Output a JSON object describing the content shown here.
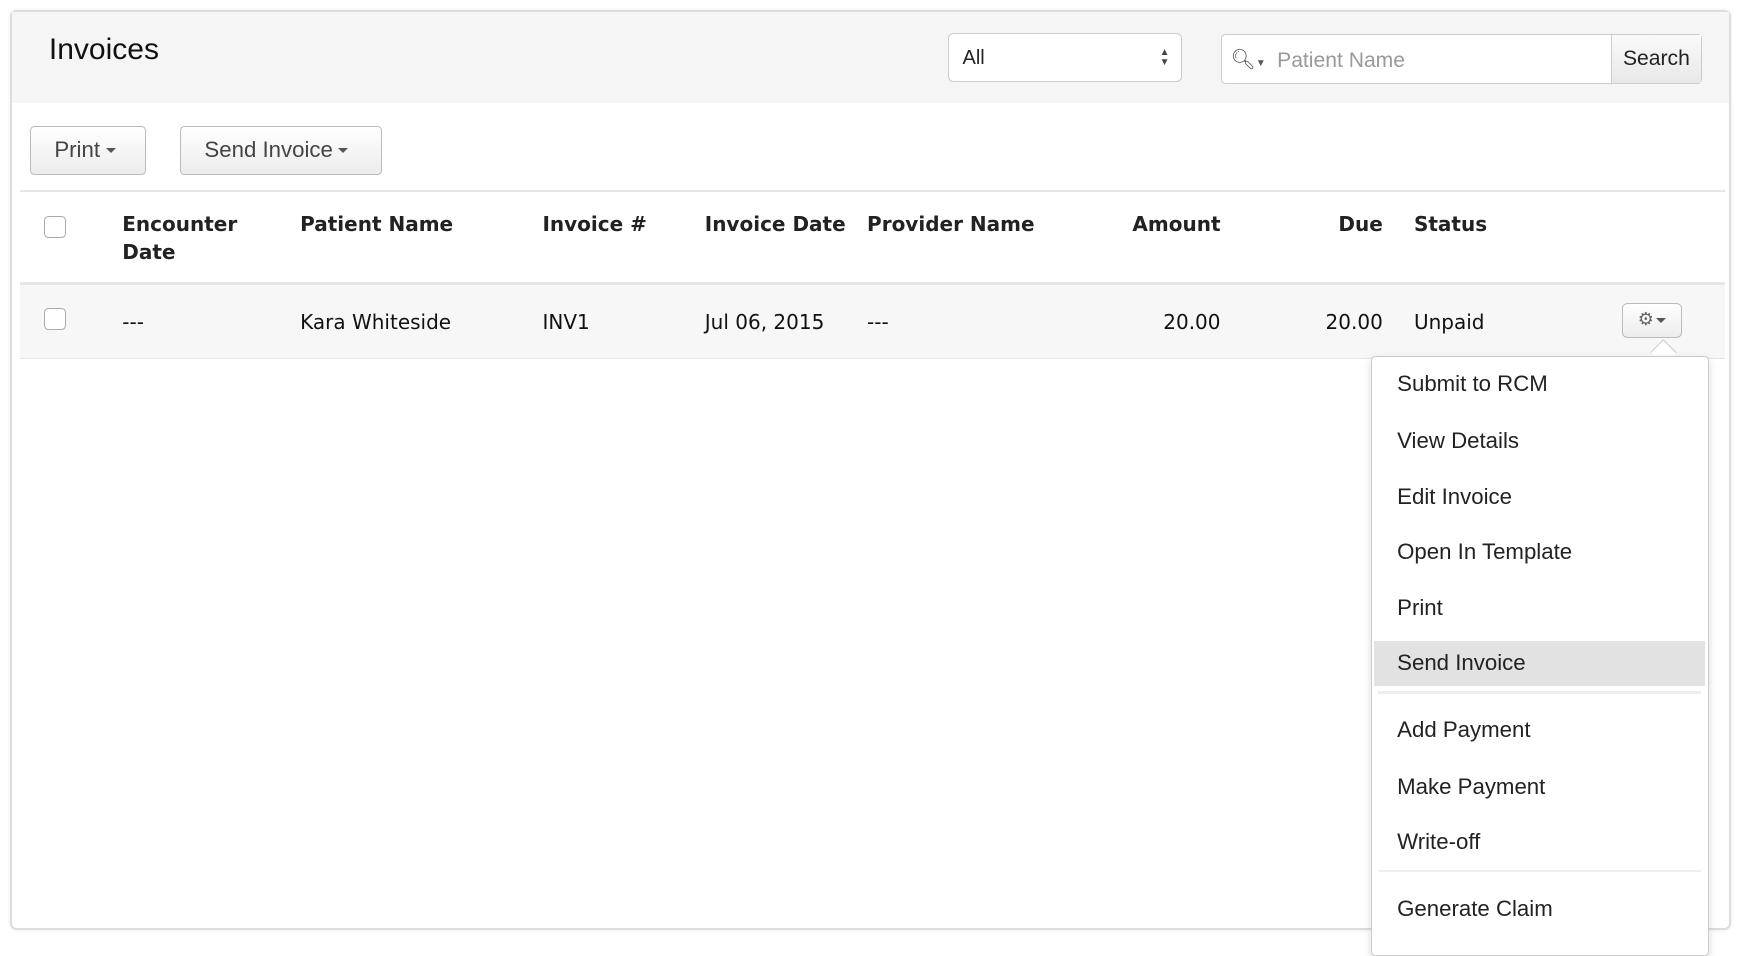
{
  "header": {
    "title": "Invoices",
    "filter_value": "All",
    "search_placeholder": "Patient Name",
    "search_button": "Search"
  },
  "toolbar": {
    "print_label": "Print",
    "send_invoice_label": "Send Invoice"
  },
  "table": {
    "columns": [
      "Encounter Date",
      "Patient Name",
      "Invoice #",
      "Invoice Date",
      "Provider Name",
      "Amount",
      "Due",
      "Status"
    ],
    "column_encounter_line1": "Encounter",
    "column_encounter_line2": "Date",
    "rows": [
      {
        "encounter_date": "---",
        "patient_name": "Kara Whiteside",
        "invoice_no": "INV1",
        "invoice_date": "Jul 06, 2015",
        "provider_name": "---",
        "amount": "20.00",
        "due": "20.00",
        "status": "Unpaid"
      }
    ]
  },
  "menu": {
    "items": [
      "Submit to RCM",
      "View Details",
      "Edit Invoice",
      "Open In Template",
      "Print",
      "Send Invoice",
      "Add Payment",
      "Make Payment",
      "Write-off",
      "Generate Claim"
    ],
    "highlighted": "Send Invoice"
  }
}
